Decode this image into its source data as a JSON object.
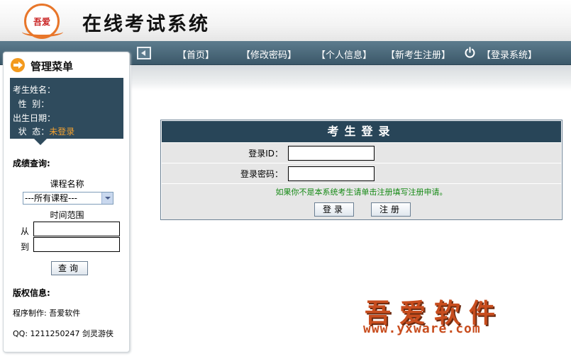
{
  "header": {
    "logo_text": "吾爱",
    "title": "在线考试系统"
  },
  "nav": {
    "items": [
      "【首页】",
      "【修改密码】",
      "【个人信息】",
      "【新考生注册】",
      "【登录系统】"
    ]
  },
  "sidebar": {
    "title": "管理菜单",
    "user": {
      "name_label": "考生姓名：",
      "gender_label": "  性  别：",
      "birth_label": "出生日期：",
      "status_label": "  状  态：",
      "status_value": "未登录"
    },
    "score_query": {
      "title": "成绩查询:",
      "course_label": "课程名称",
      "course_selected": "---所有课程---",
      "time_label": "时间范围",
      "from_label": "从",
      "to_label": "到",
      "from_value": "",
      "to_value": "",
      "query_button": "查询"
    },
    "copyright": {
      "title": "版权信息:",
      "author_line": "程序制作: 吾爱软件",
      "qq_line": "QQ: 1211250247  剑灵游侠"
    }
  },
  "login": {
    "title": "考生登录",
    "id_label": "登录ID：",
    "id_value": "",
    "password_label": "登录密码：",
    "password_value": "",
    "hint": "如果你不是本系统考生请单击注册填写注册申请。",
    "login_button": "登录",
    "register_button": "注册"
  },
  "watermark": {
    "cn": "吾爱软件",
    "url": "www.yxware.com"
  },
  "colors": {
    "nav_bg": "#3b5869",
    "panel_dark": "#284558",
    "accent_orange": "#f39a1e",
    "status_orange": "#f0a030",
    "hint_green": "#178a16"
  }
}
